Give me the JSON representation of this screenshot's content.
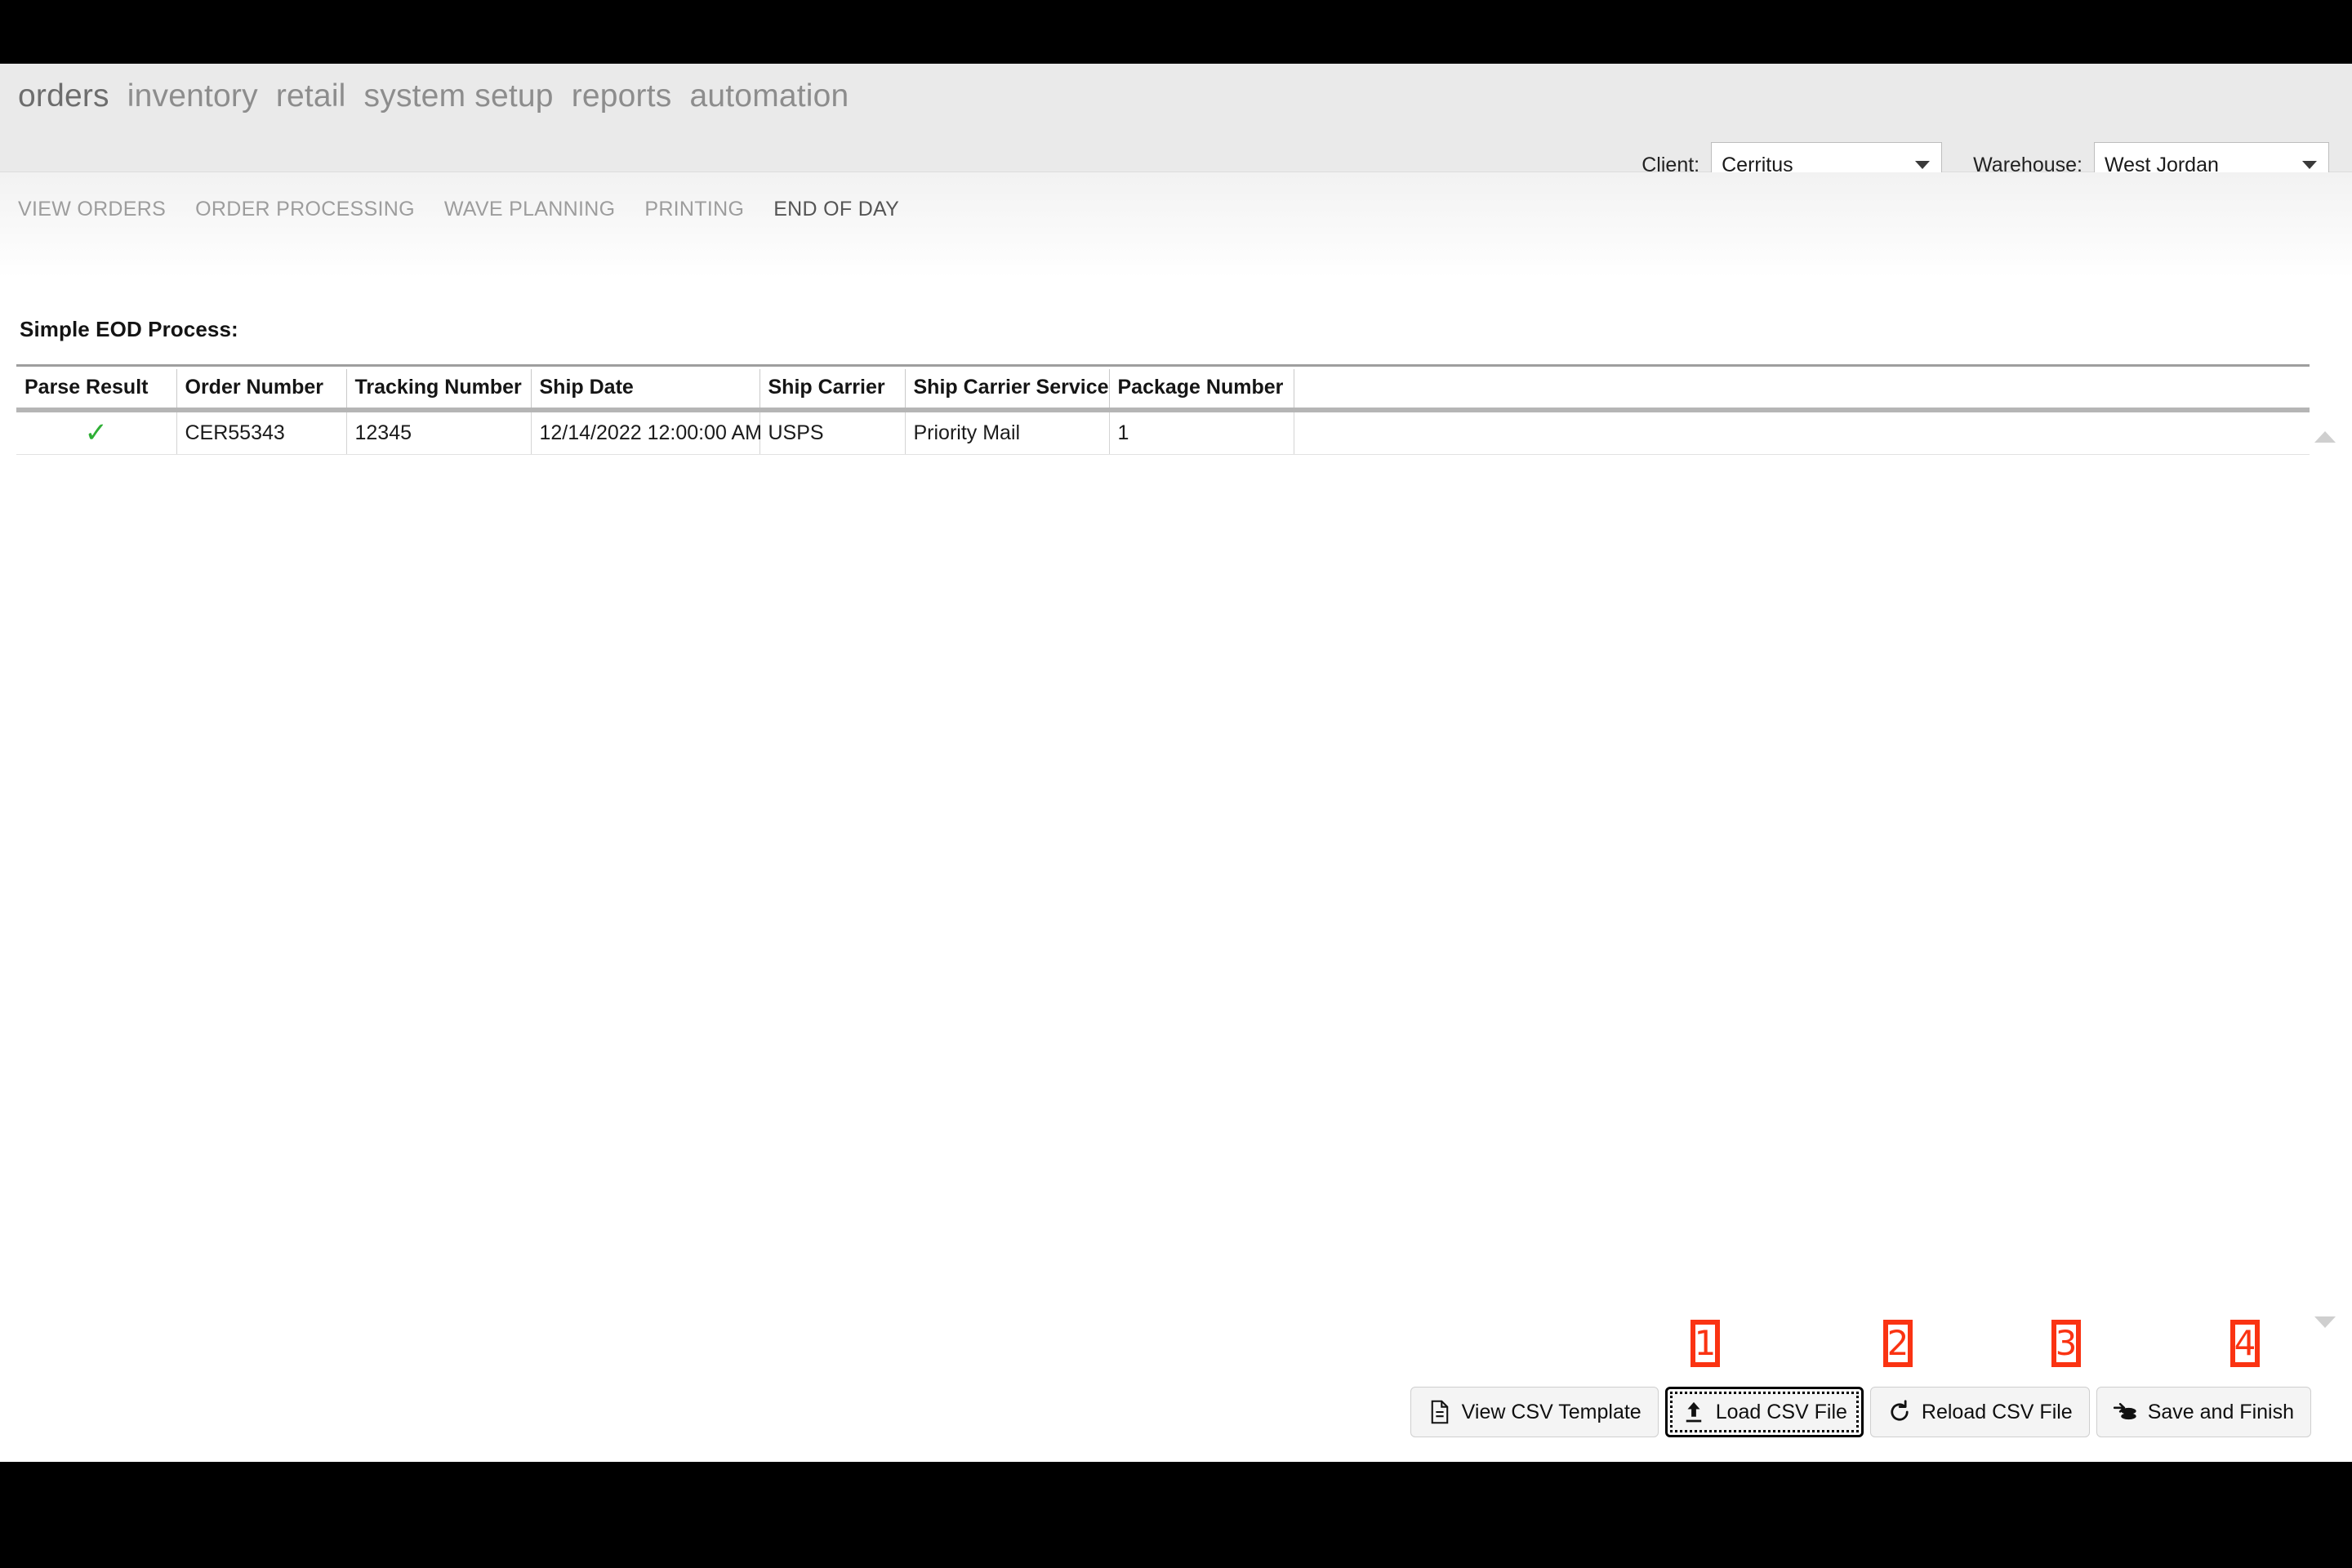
{
  "header": {
    "main_nav": [
      {
        "label": "orders",
        "active": true
      },
      {
        "label": "inventory",
        "active": false
      },
      {
        "label": "retail",
        "active": false
      },
      {
        "label": "system setup",
        "active": false
      },
      {
        "label": "reports",
        "active": false
      },
      {
        "label": "automation",
        "active": false
      }
    ],
    "sub_nav": [
      {
        "label": "VIEW ORDERS",
        "active": false
      },
      {
        "label": "ORDER PROCESSING",
        "active": false
      },
      {
        "label": "WAVE PLANNING",
        "active": false
      },
      {
        "label": "PRINTING",
        "active": false
      },
      {
        "label": "END OF DAY",
        "active": true
      }
    ],
    "client": {
      "label": "Client:",
      "value": "Cerritus",
      "caret_icon": "chevron-down-icon"
    },
    "warehouse": {
      "label": "Warehouse:",
      "value": "West Jordan",
      "caret_icon": "chevron-down-icon"
    }
  },
  "content": {
    "title": "Simple EOD Process:"
  },
  "grid": {
    "columns": [
      "Parse Result",
      "Order Number",
      "Tracking Number",
      "Ship Date",
      "Ship Carrier",
      "Ship Carrier Service",
      "Package Number",
      ""
    ],
    "rows": [
      {
        "parse_result_icon": "check-icon",
        "parse_result_glyph": "✓",
        "order_number": "CER55343",
        "tracking_number": "12345",
        "ship_date": "12/14/2022 12:00:00 AM",
        "ship_carrier": "USPS",
        "ship_carrier_service": "Priority Mail",
        "package_number": "1",
        "extra": ""
      }
    ]
  },
  "footer": {
    "buttons": [
      {
        "label": "View CSV Template",
        "icon": "file-document-icon",
        "focused": false
      },
      {
        "label": "Load CSV File",
        "icon": "upload-arrow-icon",
        "focused": true
      },
      {
        "label": "Reload CSV File",
        "icon": "refresh-icon",
        "focused": false
      },
      {
        "label": "Save and Finish",
        "icon": "database-save-icon",
        "focused": false
      }
    ]
  },
  "annotations": {
    "marker_color": "#fa3312",
    "markers": [
      {
        "number": "1"
      },
      {
        "number": "2"
      },
      {
        "number": "3"
      },
      {
        "number": "4"
      }
    ]
  },
  "scrollbar": {
    "up_arrow_icon": "triangle-up-icon",
    "down_arrow_icon": "triangle-down-icon"
  }
}
